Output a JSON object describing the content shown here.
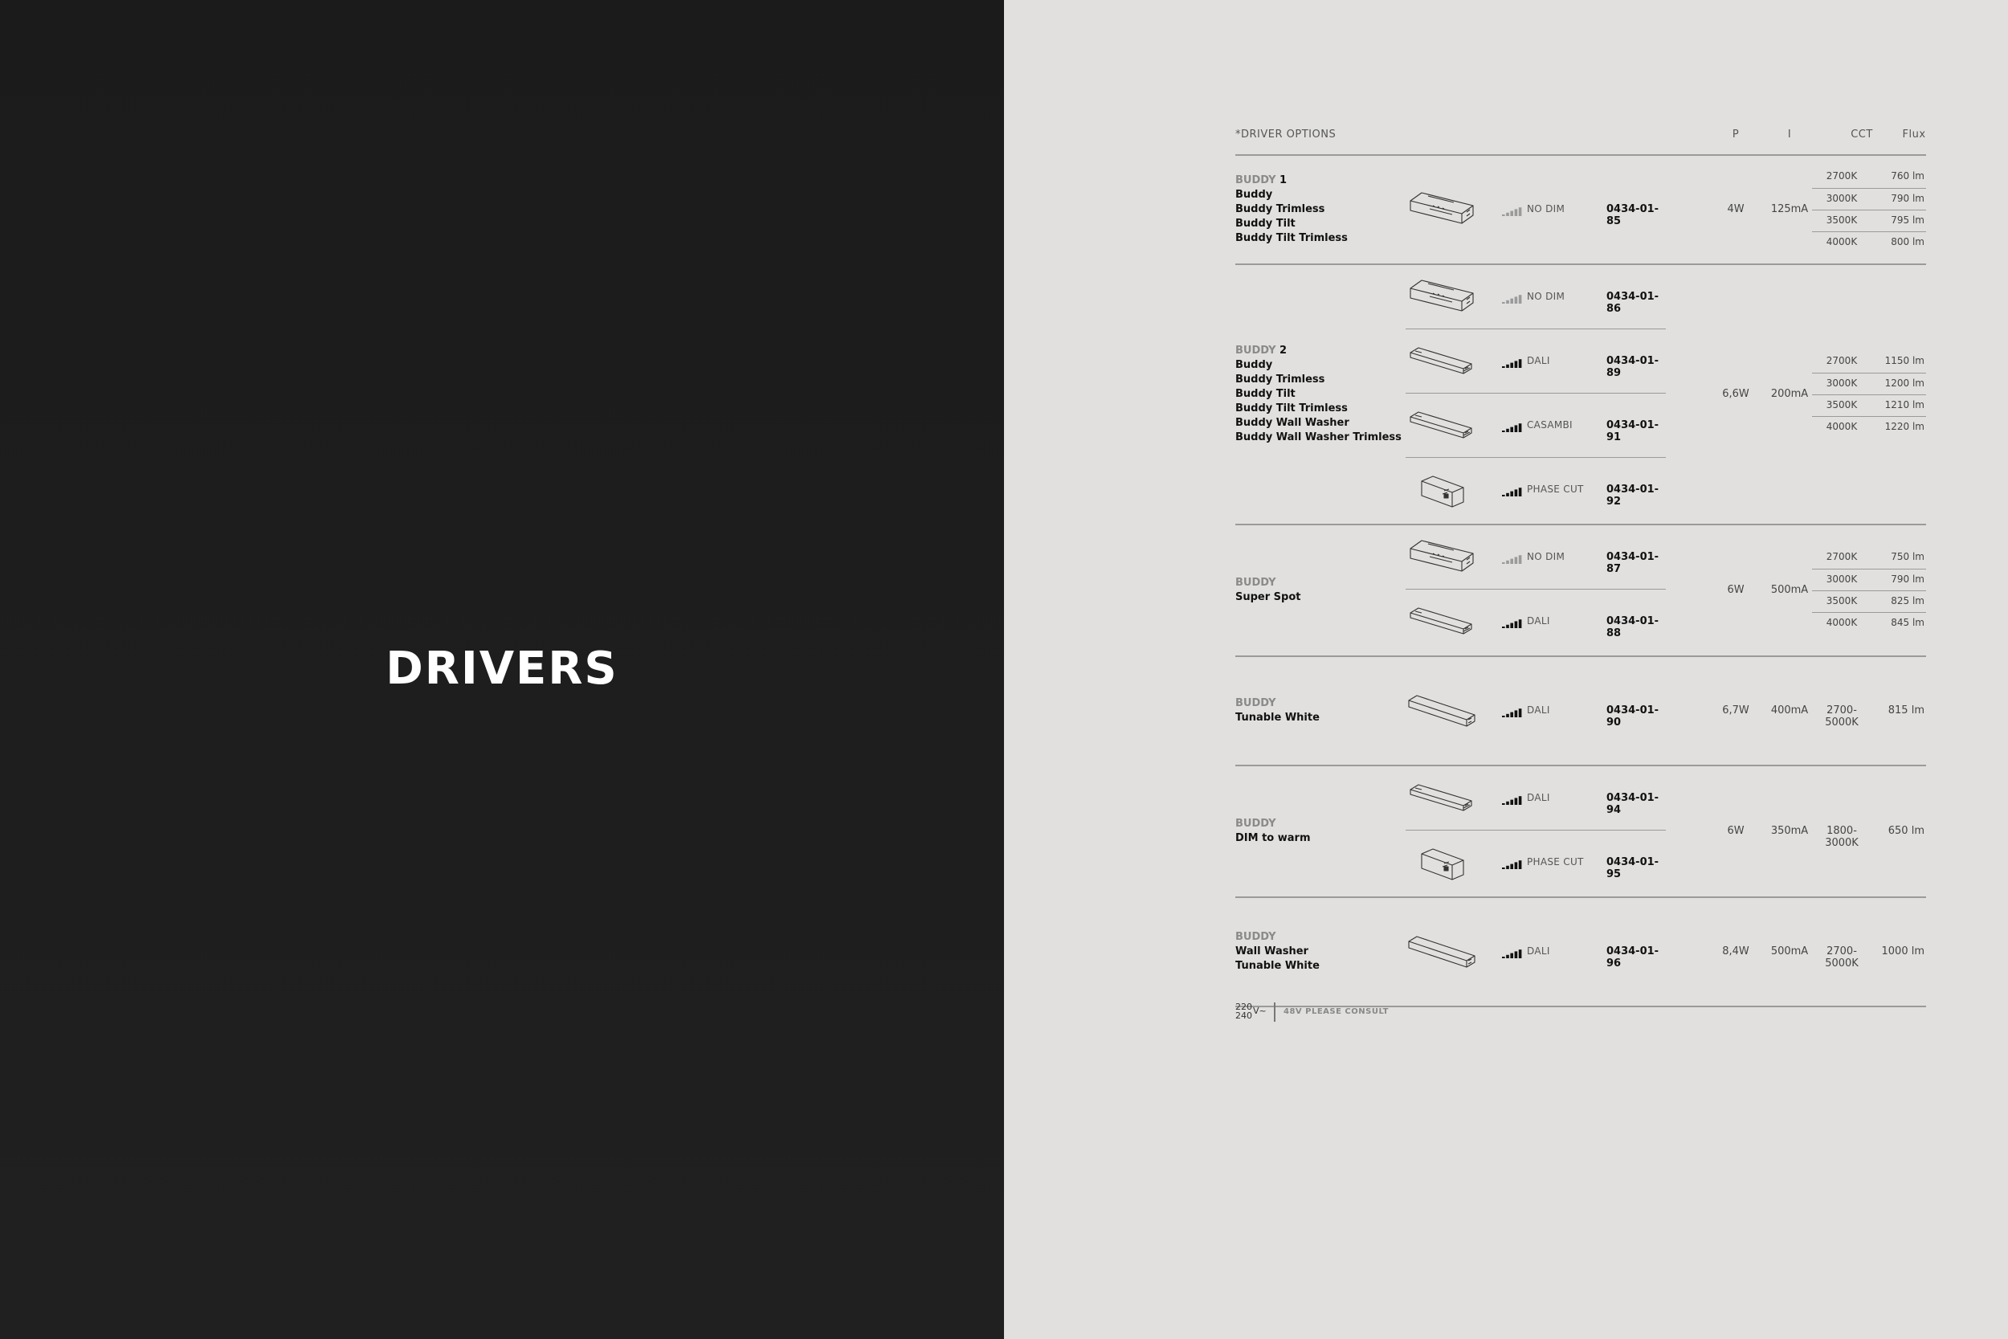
{
  "page": {
    "title": "DRIVERS"
  },
  "table": {
    "headers": {
      "options": "*DRIVER OPTIONS",
      "p": "P",
      "i": "I",
      "cct": "CCT",
      "flux": "Flux"
    },
    "groups": [
      {
        "brand": "BUDDY",
        "num": "1",
        "models": [
          "Buddy",
          "Buddy Trimless",
          "Buddy Tilt",
          "Buddy Tilt Trimless"
        ],
        "drivers": [
          {
            "type": "box",
            "dim_icon": "dim-off-icon",
            "dim": "NO DIM",
            "code": "0434-01-85"
          }
        ],
        "p": "4W",
        "i": "125mA",
        "cct": [
          {
            "k": "2700K",
            "flux": "760 lm"
          },
          {
            "k": "3000K",
            "flux": "790 lm"
          },
          {
            "k": "3500K",
            "flux": "795 lm"
          },
          {
            "k": "4000K",
            "flux": "800 lm"
          }
        ]
      },
      {
        "brand": "BUDDY",
        "num": "2",
        "models": [
          "Buddy",
          "Buddy Trimless",
          "Buddy Tilt",
          "Buddy Tilt Trimless",
          "Buddy Wall Washer",
          "Buddy Wall Washer Trimless"
        ],
        "drivers": [
          {
            "type": "box",
            "dim_icon": "dim-off-icon",
            "dim": "NO DIM",
            "code": "0434-01-86"
          },
          {
            "type": "slim",
            "dim_icon": "dim-on-icon",
            "dim": "DALI",
            "code": "0434-01-89"
          },
          {
            "type": "slim",
            "dim_icon": "dim-on-icon",
            "dim": "CASAMBI",
            "code": "0434-01-91"
          },
          {
            "type": "small",
            "dim_icon": "dim-on-icon",
            "dim": "PHASE CUT",
            "code": "0434-01-92"
          }
        ],
        "p": "6,6W",
        "i": "200mA",
        "cct": [
          {
            "k": "2700K",
            "flux": "1150 lm"
          },
          {
            "k": "3000K",
            "flux": "1200 lm"
          },
          {
            "k": "3500K",
            "flux": "1210 lm"
          },
          {
            "k": "4000K",
            "flux": "1220 lm"
          }
        ]
      },
      {
        "brand": "BUDDY",
        "num": "",
        "models": [
          "Super Spot"
        ],
        "drivers": [
          {
            "type": "box",
            "dim_icon": "dim-off-icon",
            "dim": "NO DIM",
            "code": "0434-01-87"
          },
          {
            "type": "slim",
            "dim_icon": "dim-on-icon",
            "dim": "DALI",
            "code": "0434-01-88"
          }
        ],
        "p": "6W",
        "i": "500mA",
        "cct": [
          {
            "k": "2700K",
            "flux": "750 lm"
          },
          {
            "k": "3000K",
            "flux": "790 lm"
          },
          {
            "k": "3500K",
            "flux": "825 lm"
          },
          {
            "k": "4000K",
            "flux": "845 lm"
          }
        ]
      },
      {
        "brand": "BUDDY",
        "num": "",
        "models": [
          "Tunable White"
        ],
        "drivers": [
          {
            "type": "long",
            "dim_icon": "dim-on-icon",
            "dim": "DALI",
            "code": "0434-01-90"
          }
        ],
        "p": "6,7W",
        "i": "400mA",
        "cct_range": "2700-5000K",
        "flux": "815 lm"
      },
      {
        "brand": "BUDDY",
        "num": "",
        "models": [
          "DIM to warm"
        ],
        "drivers": [
          {
            "type": "slim",
            "dim_icon": "dim-on-icon",
            "dim": "DALI",
            "code": "0434-01-94"
          },
          {
            "type": "small",
            "dim_icon": "dim-on-icon",
            "dim": "PHASE CUT",
            "code": "0434-01-95"
          }
        ],
        "p": "6W",
        "i": "350mA",
        "cct_range": "1800-3000K",
        "flux": "650 lm"
      },
      {
        "brand": "BUDDY",
        "num": "",
        "models": [
          "Wall Washer",
          "Tunable White"
        ],
        "drivers": [
          {
            "type": "long",
            "dim_icon": "dim-on-icon",
            "dim": "DALI",
            "code": "0434-01-96"
          }
        ],
        "p": "8,4W",
        "i": "500mA",
        "cct_range": "2700-5000K",
        "flux": "1000 lm"
      }
    ]
  },
  "footer": {
    "voltage_top": "220",
    "voltage_bottom": "240",
    "voltage_unit": "V~",
    "note": "48V PLEASE CONSULT"
  },
  "colors": {
    "dark_panel": "#1d1d1d",
    "light_panel": "#e1e0de",
    "brand_grey": "#8a8a8a",
    "rule": "#9a9a9a"
  }
}
